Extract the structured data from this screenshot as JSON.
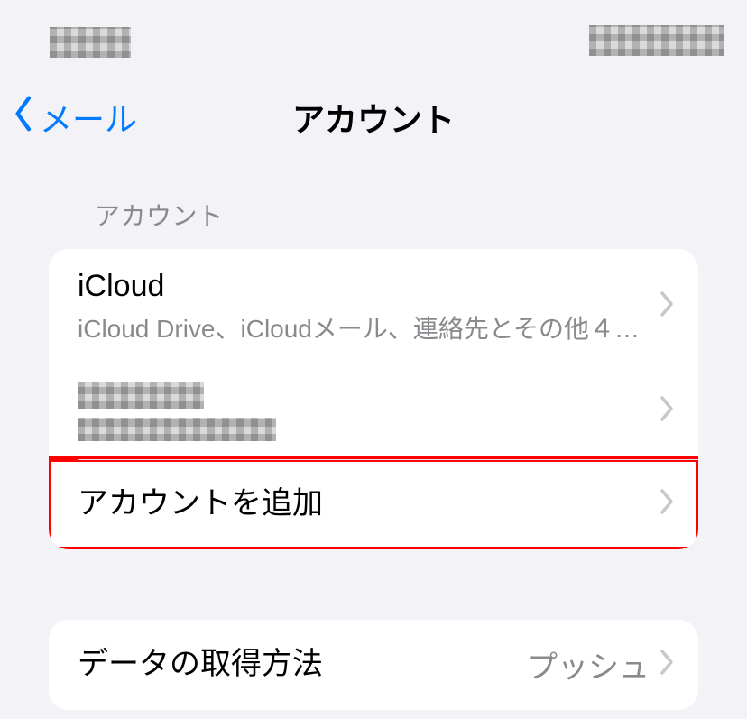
{
  "nav": {
    "back_label": "メール",
    "title": "アカウント"
  },
  "section_header": "アカウント",
  "accounts": [
    {
      "title": "iCloud",
      "subtitle": "iCloud Drive、iCloudメール、連絡先とその他４項目..."
    },
    {
      "title": "",
      "subtitle": "",
      "redacted": true
    }
  ],
  "add_account_label": "アカウントを追加",
  "fetch": {
    "label": "データの取得方法",
    "value": "プッシュ"
  }
}
